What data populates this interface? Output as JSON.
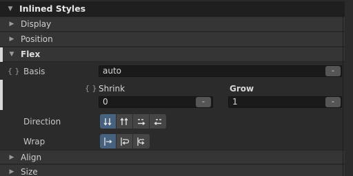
{
  "header": {
    "title": "Inlined Styles"
  },
  "sections": {
    "display": "Display",
    "position": "Position",
    "flex": "Flex",
    "align": "Align",
    "size": "Size"
  },
  "flex": {
    "basis": {
      "label": "Basis",
      "value": "auto",
      "button": "-"
    },
    "shrink": {
      "label": "Shrink",
      "value": "0",
      "button": "-"
    },
    "grow": {
      "label": "Grow",
      "value": "1",
      "button": "-"
    },
    "direction": {
      "label": "Direction",
      "options": [
        "column",
        "column-reverse",
        "row",
        "row-reverse"
      ],
      "selected": "column"
    },
    "wrap": {
      "label": "Wrap",
      "options": [
        "nowrap",
        "wrap",
        "wrap-reverse"
      ],
      "selected": "nowrap"
    }
  },
  "icons": {
    "braces": "{ }"
  },
  "colors": {
    "active": "#46627f",
    "accent": "#d8d8d8"
  }
}
